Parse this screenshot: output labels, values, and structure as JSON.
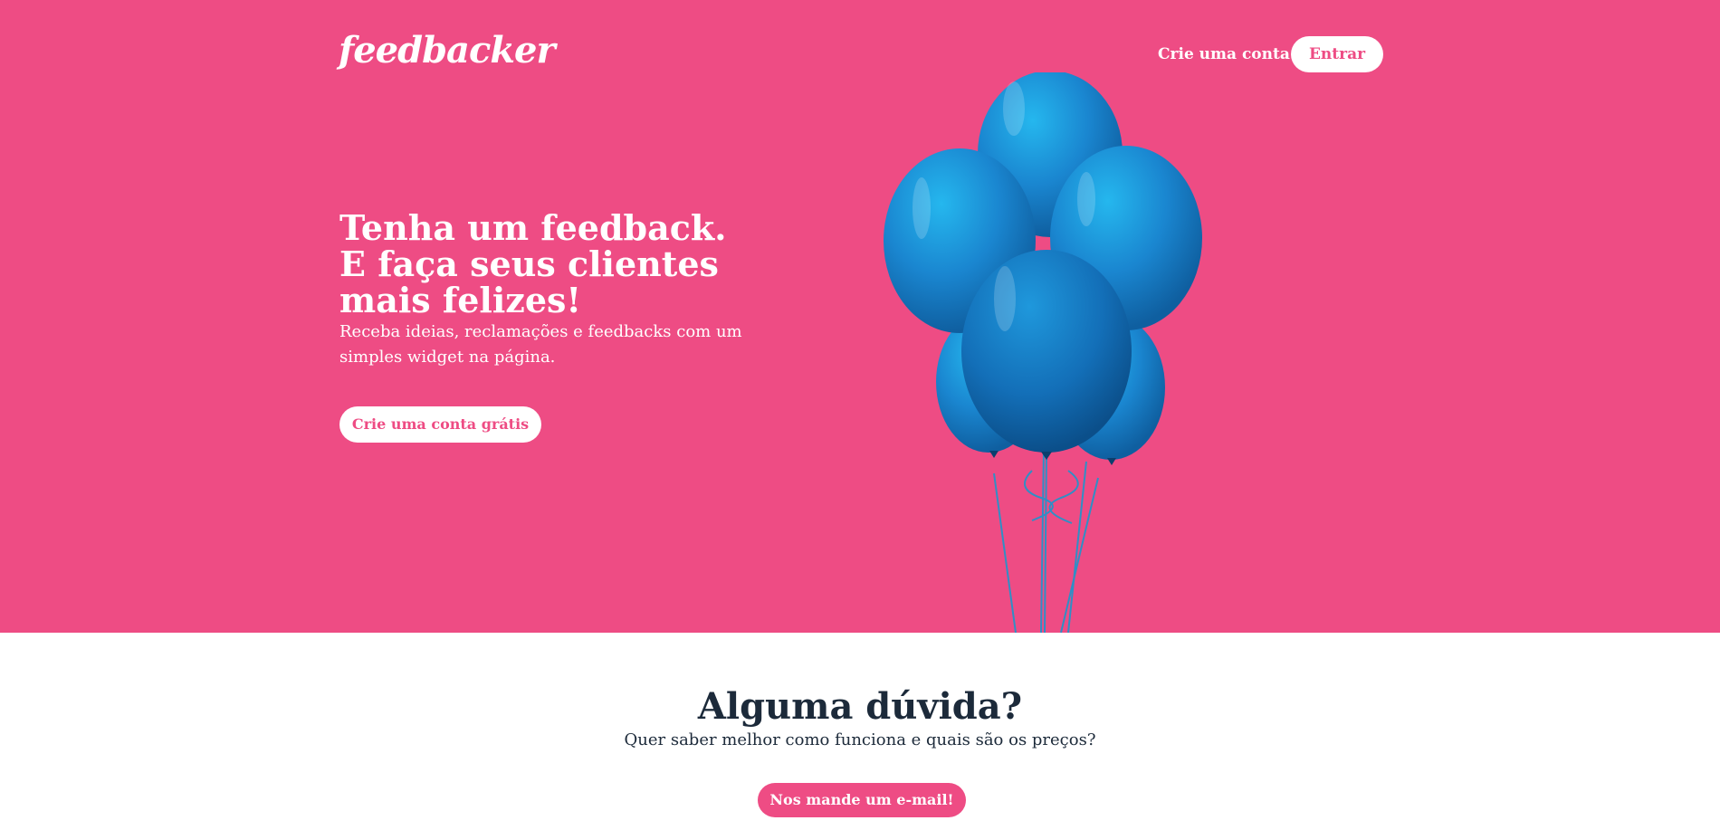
{
  "colors": {
    "brand": "#ee4c84",
    "text_dark": "#1c2a3a",
    "balloon": "#1a86d0"
  },
  "header": {
    "logo": "feedbacker",
    "signup_label": "Crie uma conta",
    "login_label": "Entrar"
  },
  "hero": {
    "headline_line1": "Tenha um feedback.",
    "headline_line2": "E faça seus clientes mais felizes!",
    "subtitle": "Receba ideias, reclamações e feedbacks com um simples widget na página.",
    "cta_label": "Crie uma conta grátis",
    "image": "blue-balloons-image"
  },
  "faq": {
    "title": "Alguma dúvida?",
    "subtitle": "Quer saber melhor como funciona e quais são os preços?",
    "button_label": "Nos mande um e-mail!"
  }
}
